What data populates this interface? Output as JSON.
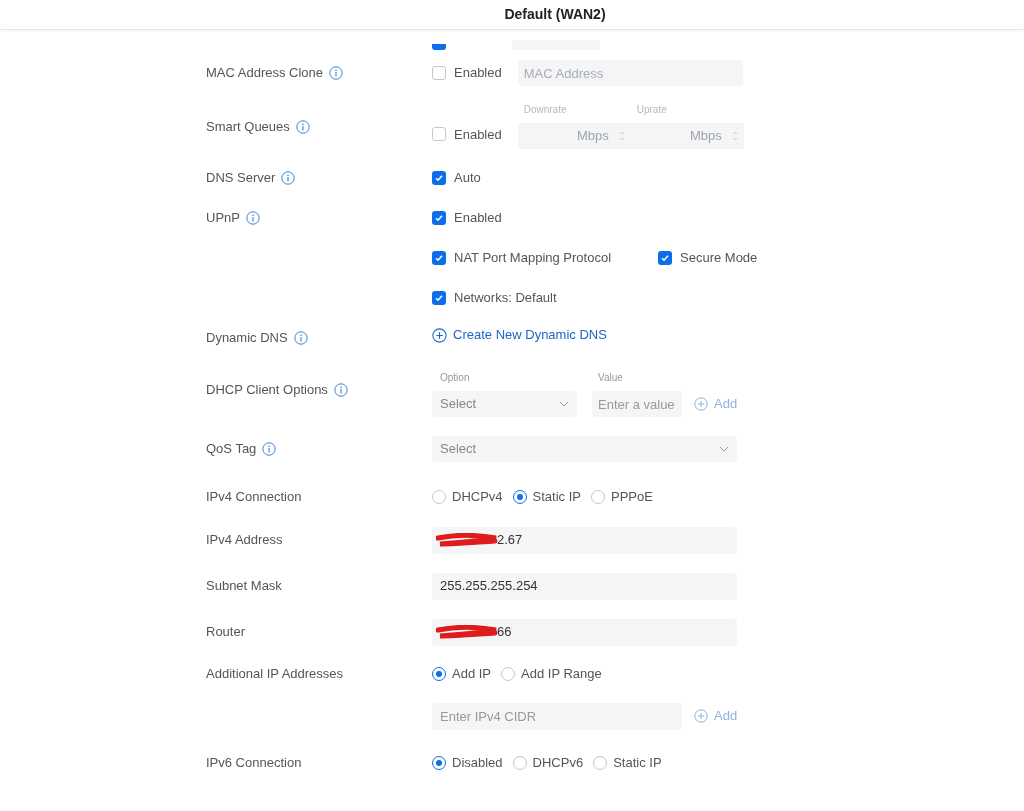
{
  "header": {
    "title": "Default (WAN2)"
  },
  "rows": [
    {
      "kind": "partial",
      "checked": true
    },
    {
      "kind": "checkbox_field",
      "label": "MAC Address Clone",
      "info": true,
      "checkbox": {
        "label": "Enabled",
        "checked": false
      },
      "field": {
        "placeholder": "MAC Address"
      }
    },
    {
      "kind": "queues",
      "label": "Smart Queues",
      "info": true,
      "checkbox": {
        "label": "Enabled",
        "checked": false
      },
      "fields": [
        {
          "caption": "Downrate",
          "unit": "Mbps"
        },
        {
          "caption": "Uprate",
          "unit": "Mbps"
        }
      ]
    },
    {
      "kind": "checkbox",
      "label": "DNS Server",
      "info": true,
      "checkboxes": [
        {
          "label": "Auto",
          "checked": true
        }
      ]
    },
    {
      "kind": "checkbox",
      "label": "UPnP",
      "info": true,
      "checkboxes": [
        {
          "label": "Enabled",
          "checked": true
        }
      ]
    },
    {
      "kind": "checkbox",
      "checkboxes": [
        {
          "label": "NAT Port Mapping Protocol",
          "checked": true
        },
        {
          "label": "Secure Mode",
          "checked": true
        }
      ]
    },
    {
      "kind": "checkbox",
      "checkboxes": [
        {
          "label": "Networks: Default",
          "checked": true
        }
      ]
    },
    {
      "kind": "link",
      "label": "Dynamic DNS",
      "info": true,
      "link": "Create New Dynamic DNS"
    },
    {
      "kind": "option_value",
      "label": "DHCP Client Options",
      "info": true,
      "option": {
        "caption": "Option",
        "placeholder": "Select"
      },
      "value": {
        "caption": "Value",
        "placeholder": "Enter a value"
      },
      "add": {
        "label": "Add",
        "disabled": true
      }
    },
    {
      "kind": "select",
      "label": "QoS Tag",
      "info": true,
      "placeholder": "Select"
    },
    {
      "kind": "radio",
      "label": "IPv4 Connection",
      "options": [
        {
          "label": "DHCPv4",
          "selected": false
        },
        {
          "label": "Static IP",
          "selected": true
        },
        {
          "label": "PPPoE",
          "selected": false
        }
      ]
    },
    {
      "kind": "text",
      "label": "IPv4 Address",
      "value": "2.67",
      "redacted": true
    },
    {
      "kind": "text",
      "label": "Subnet Mask",
      "value": "255.255.255.254"
    },
    {
      "kind": "text",
      "label": "Router",
      "value": "66",
      "redacted": true
    },
    {
      "kind": "radio",
      "label": "Additional IP Addresses",
      "options": [
        {
          "label": "Add IP",
          "selected": true
        },
        {
          "label": "Add IP Range",
          "selected": false
        }
      ]
    },
    {
      "kind": "cidr",
      "placeholder": "Enter IPv4 CIDR",
      "add": {
        "label": "Add",
        "disabled": true
      }
    },
    {
      "kind": "radio",
      "label": "IPv6 Connection",
      "options": [
        {
          "label": "Disabled",
          "selected": true
        },
        {
          "label": "DHCPv6",
          "selected": false
        },
        {
          "label": "Static IP",
          "selected": false
        }
      ]
    }
  ]
}
